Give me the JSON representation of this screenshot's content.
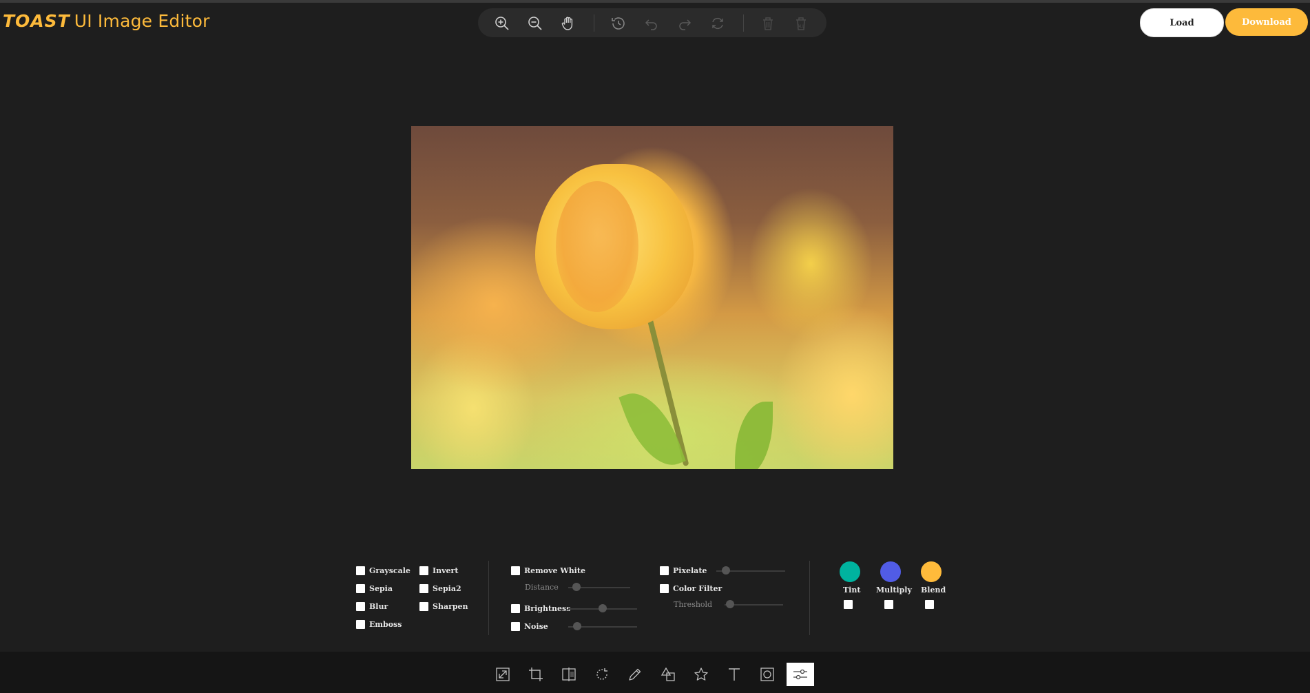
{
  "app": {
    "logo_brand": "TOAST",
    "logo_title": "UI Image Editor"
  },
  "header": {
    "load_label": "Load",
    "download_label": "Download"
  },
  "zoom_toolbar": {
    "icons": [
      "zoom-in-icon",
      "zoom-out-icon",
      "hand-icon",
      "history-icon",
      "undo-icon",
      "redo-icon",
      "reset-icon",
      "delete-icon",
      "delete-all-icon"
    ]
  },
  "filters": {
    "basic": [
      "Grayscale",
      "Invert",
      "Sepia",
      "Sepia2",
      "Blur",
      "Sharpen",
      "Emboss"
    ],
    "remove_white": "Remove White",
    "distance": "Distance",
    "brightness": "Brightness",
    "noise": "Noise",
    "pixelate": "Pixelate",
    "color_filter": "Color Filter",
    "threshold": "Threshold",
    "tint": "Tint",
    "multiply": "Multiply",
    "blend": "Blend"
  },
  "colors": {
    "accent": "#fdba3b",
    "tint": "#00b39f",
    "multiply": "#515ce6",
    "blend": "#ffbb3b"
  },
  "bottom_tools": {
    "icons": [
      "resize-icon",
      "crop-icon",
      "flip-icon",
      "rotate-icon",
      "draw-icon",
      "shape-icon",
      "icon-star-icon",
      "text-icon",
      "mask-icon",
      "filter-icon"
    ],
    "active": "filter-icon"
  }
}
